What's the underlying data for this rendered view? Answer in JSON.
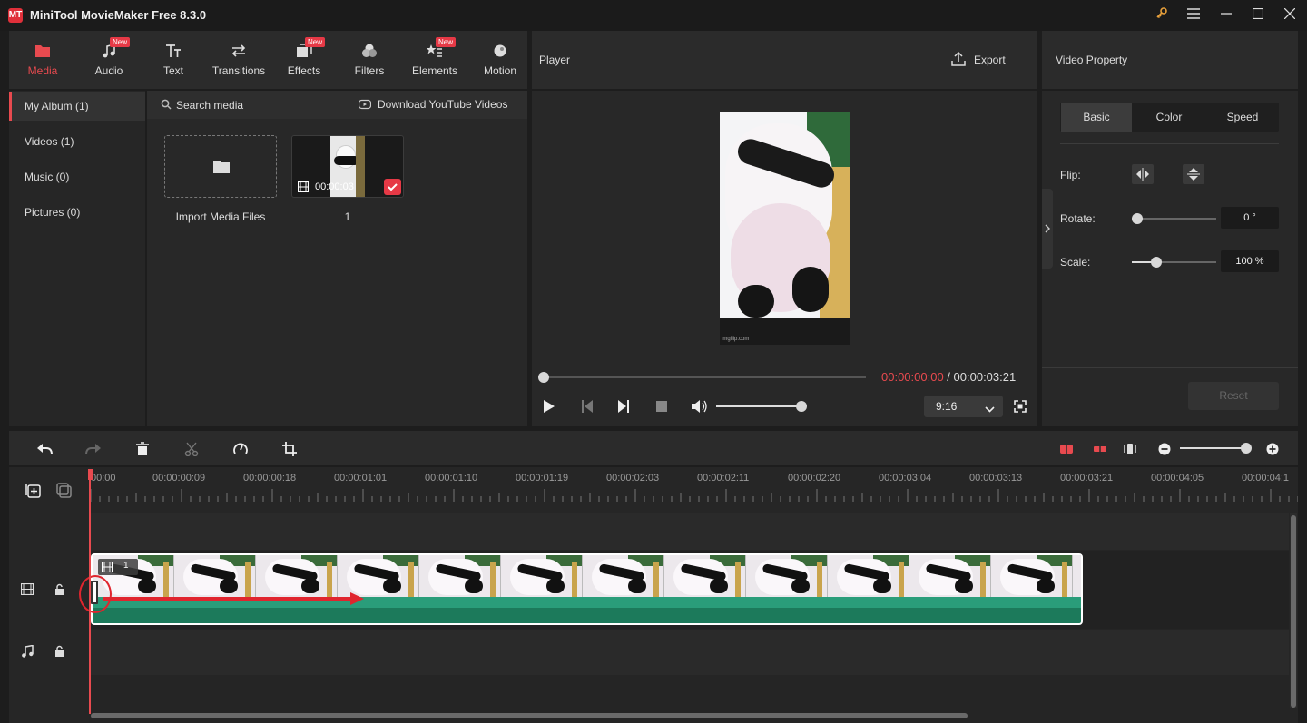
{
  "app": {
    "title": "MiniTool MovieMaker Free 8.3.0",
    "logo": "MT"
  },
  "window_controls": [
    "key-icon",
    "menu-icon",
    "minimize-icon",
    "maximize-icon",
    "close-icon"
  ],
  "toolbar": {
    "items": [
      {
        "label": "Media",
        "icon": "media-folder-icon",
        "active": true,
        "new": false
      },
      {
        "label": "Audio",
        "icon": "music-icon",
        "active": false,
        "new": true
      },
      {
        "label": "Text",
        "icon": "text-icon",
        "active": false,
        "new": false
      },
      {
        "label": "Transitions",
        "icon": "transitions-icon",
        "active": false,
        "new": false
      },
      {
        "label": "Effects",
        "icon": "effects-icon",
        "active": false,
        "new": true
      },
      {
        "label": "Filters",
        "icon": "filters-icon",
        "active": false,
        "new": false
      },
      {
        "label": "Elements",
        "icon": "elements-icon",
        "active": false,
        "new": true
      },
      {
        "label": "Motion",
        "icon": "motion-icon",
        "active": false,
        "new": false
      }
    ],
    "new_label": "New"
  },
  "sidebar": {
    "items": [
      {
        "label": "My Album (1)",
        "active": true
      },
      {
        "label": "Videos (1)",
        "active": false
      },
      {
        "label": "Music (0)",
        "active": false
      },
      {
        "label": "Pictures (0)",
        "active": false
      }
    ]
  },
  "media": {
    "search_placeholder": "Search media",
    "download_label": "Download YouTube Videos",
    "import_label": "Import Media Files",
    "clip": {
      "duration": "00:00:03",
      "name": "1"
    }
  },
  "player": {
    "title": "Player",
    "export_label": "Export",
    "current_time": "00:00:00:00",
    "separator": " / ",
    "total_time": "00:00:03:21",
    "aspect_ratio": "9:16",
    "watermark": "imgflip.com"
  },
  "property": {
    "title": "Video Property",
    "tabs": [
      "Basic",
      "Color",
      "Speed"
    ],
    "active_tab": "Basic",
    "flip_label": "Flip:",
    "rotate_label": "Rotate:",
    "rotate_value": "0 °",
    "scale_label": "Scale:",
    "scale_value": "100 %",
    "reset_label": "Reset"
  },
  "timeline": {
    "ruler": [
      "00:00",
      "00:00:00:09",
      "00:00:00:18",
      "00:00:01:01",
      "00:00:01:10",
      "00:00:01:19",
      "00:00:02:03",
      "00:00:02:11",
      "00:00:02:20",
      "00:00:03:04",
      "00:00:03:13",
      "00:00:03:21",
      "00:00:04:05",
      "00:00:04:1"
    ],
    "clip_label": "1"
  },
  "colors": {
    "accent": "#e84a4f",
    "track_green": "#2a9d7a",
    "panel": "#2a2a2a",
    "dark": "#1b1b1b"
  }
}
